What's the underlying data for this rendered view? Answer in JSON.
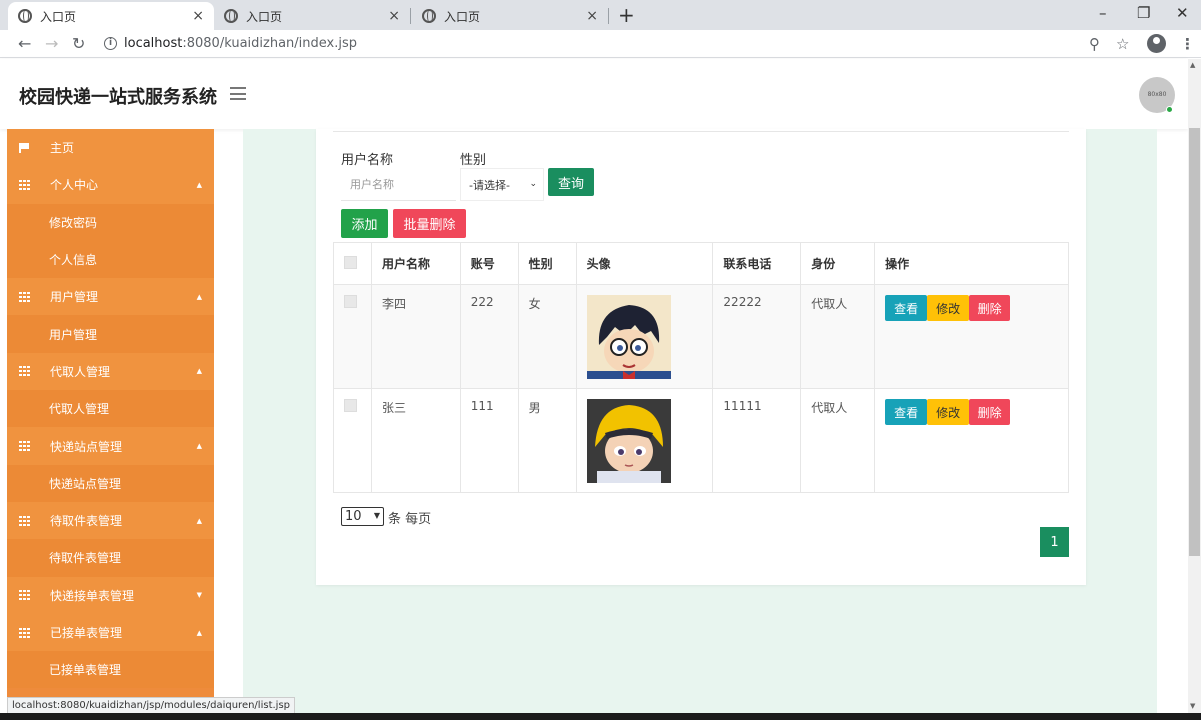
{
  "browser": {
    "tabs": [
      {
        "title": "入口页",
        "close": "×"
      },
      {
        "title": "入口页",
        "close": "×"
      },
      {
        "title": "入口页",
        "close": "×"
      }
    ],
    "new_tab": "+",
    "url_host": "localhost",
    "url_rest": ":8080/kuaidizhan/index.jsp",
    "status_url": "localhost:8080/kuaidizhan/jsp/modules/daiquren/list.jsp"
  },
  "header": {
    "title": "校园快递一站式服务系统",
    "avatar_text": "80x80"
  },
  "sidebar": {
    "items": [
      {
        "label": "主页",
        "type": "group",
        "icon": "flag-icon"
      },
      {
        "label": "个人中心",
        "type": "group",
        "icon": "grid-icon",
        "caret": "▲"
      },
      {
        "label": "修改密码",
        "type": "sub"
      },
      {
        "label": "个人信息",
        "type": "sub"
      },
      {
        "label": "用户管理",
        "type": "group",
        "icon": "grid-icon",
        "caret": "▲"
      },
      {
        "label": "用户管理",
        "type": "sub"
      },
      {
        "label": "代取人管理",
        "type": "group",
        "icon": "grid-icon",
        "caret": "▲"
      },
      {
        "label": "代取人管理",
        "type": "sub"
      },
      {
        "label": "快递站点管理",
        "type": "group",
        "icon": "grid-icon",
        "caret": "▲"
      },
      {
        "label": "快递站点管理",
        "type": "sub"
      },
      {
        "label": "待取件表管理",
        "type": "group",
        "icon": "grid-icon",
        "caret": "▲"
      },
      {
        "label": "待取件表管理",
        "type": "sub"
      },
      {
        "label": "快递接单表管理",
        "type": "group",
        "icon": "grid-icon",
        "caret": "▼"
      },
      {
        "label": "已接单表管理",
        "type": "group",
        "icon": "grid-icon",
        "caret": "▲"
      },
      {
        "label": "已接单表管理",
        "type": "sub"
      }
    ]
  },
  "filter": {
    "username_label": "用户名称",
    "username_placeholder": "用户名称",
    "gender_label": "性别",
    "gender_selected": "-请选择-",
    "query_button": "查询"
  },
  "actions": {
    "add": "添加",
    "batch_delete": "批量删除"
  },
  "table": {
    "headers": [
      "用户名称",
      "账号",
      "性别",
      "头像",
      "联系电话",
      "身份",
      "操作"
    ],
    "rows": [
      {
        "name": "李四",
        "account": "222",
        "gender": "女",
        "phone": "22222",
        "role": "代取人"
      },
      {
        "name": "张三",
        "account": "111",
        "gender": "男",
        "phone": "11111",
        "role": "代取人"
      }
    ],
    "op_view": "查看",
    "op_edit": "修改",
    "op_delete": "删除"
  },
  "pagination": {
    "page_size": "10",
    "page_size_suffix": "条 每页",
    "current_page": "1"
  },
  "colors": {
    "sidebar": "#ee8b3b",
    "primary_green": "#1a8e5f",
    "danger": "#f0475a",
    "info": "#17a2b8",
    "warning": "#ffc107"
  }
}
